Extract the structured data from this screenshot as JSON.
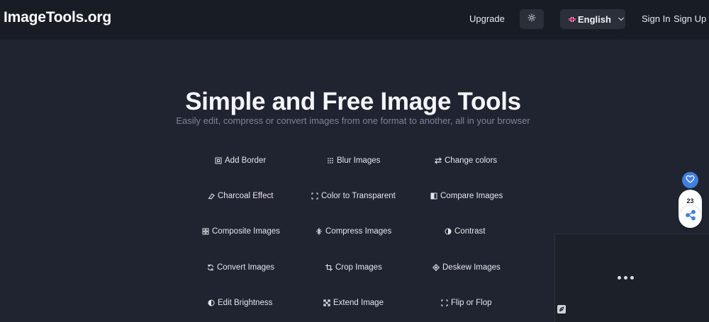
{
  "header": {
    "logo": "ImageTools.org",
    "upgrade_label": "Upgrade",
    "theme_icon": "sun-icon",
    "language": {
      "selected": "English",
      "flag_icon": "uk-flag-icon",
      "chevron_icon": "chevron-down-icon"
    },
    "sign_in_label": "Sign In",
    "sign_up_label": "Sign Up"
  },
  "hero": {
    "title": "Simple and Free Image Tools",
    "subtitle": "Easily edit, compress or convert images from one format to another, all in your browser"
  },
  "tools": [
    {
      "label": "Add Border",
      "icon": "border-icon"
    },
    {
      "label": "Blur Images",
      "icon": "blur-icon"
    },
    {
      "label": "Change colors",
      "icon": "swap-arrows-icon"
    },
    {
      "label": "Charcoal Effect",
      "icon": "charcoal-icon"
    },
    {
      "label": "Color to Transparent",
      "icon": "transparent-frame-icon"
    },
    {
      "label": "Compare Images",
      "icon": "compare-icon"
    },
    {
      "label": "Composite Images",
      "icon": "composite-grid-icon"
    },
    {
      "label": "Compress Images",
      "icon": "compress-icon"
    },
    {
      "label": "Contrast",
      "icon": "contrast-icon"
    },
    {
      "label": "Convert Images",
      "icon": "convert-cycle-icon"
    },
    {
      "label": "Crop Images",
      "icon": "crop-icon"
    },
    {
      "label": "Deskew Images",
      "icon": "deskew-icon"
    },
    {
      "label": "Edit Brightness",
      "icon": "brightness-icon"
    },
    {
      "label": "Extend Image",
      "icon": "extend-arrows-icon"
    },
    {
      "label": "Flip or Flop",
      "icon": "flip-frame-icon"
    }
  ],
  "side_widget": {
    "like_icon": "heart-icon",
    "count": "23",
    "share_icon": "share-icon"
  },
  "ad": {
    "menu_icon": "more-dots-icon",
    "badge_icon": "leaf-icon"
  },
  "colors": {
    "background": "#1f2430",
    "header": "#181c24",
    "like_blue": "#3f7fe0"
  }
}
